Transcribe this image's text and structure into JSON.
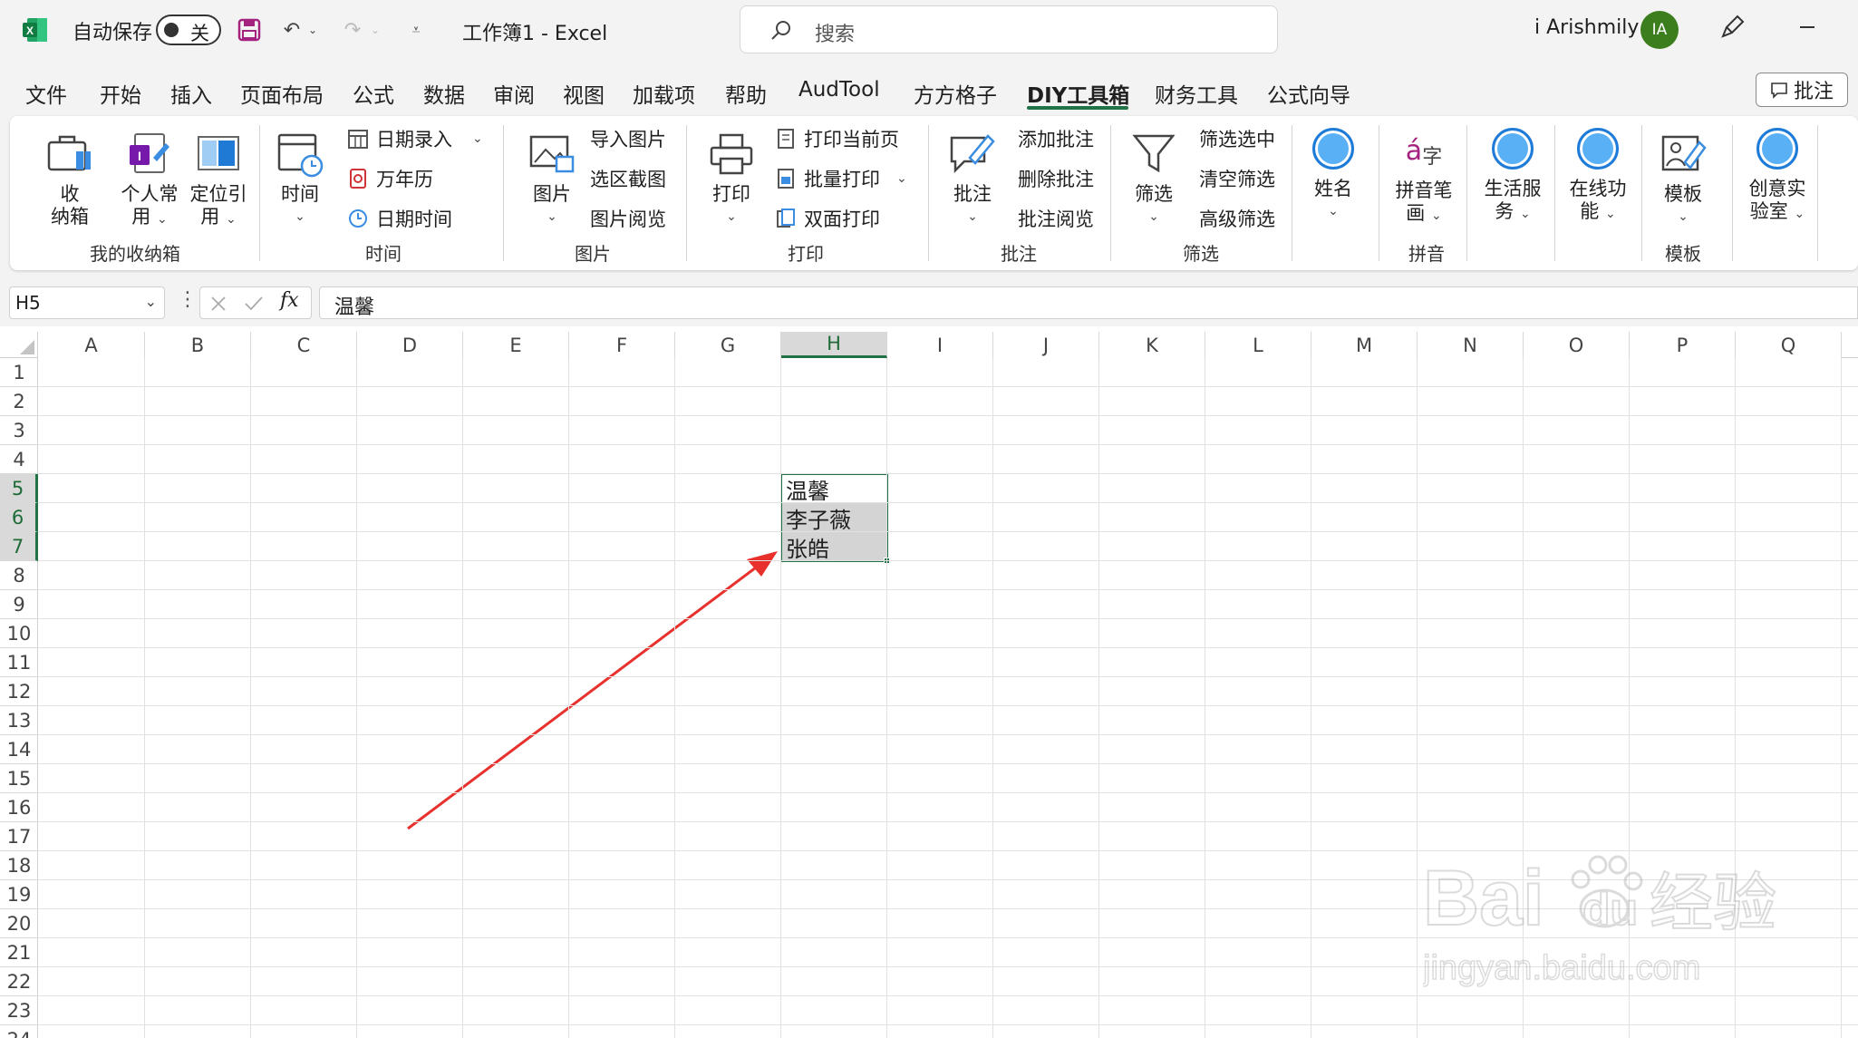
{
  "titlebar": {
    "autosave_label": "自动保存",
    "autosave_state": "关",
    "doc_title": "工作簿1  -  Excel",
    "search_placeholder": "搜索",
    "user_name": "i Arishmily",
    "avatar_initials": "IA"
  },
  "menu": {
    "tabs": [
      "文件",
      "开始",
      "插入",
      "页面布局",
      "公式",
      "数据",
      "审阅",
      "视图",
      "加载项",
      "帮助",
      "AudTool",
      "方方格子",
      "DIY工具箱",
      "财务工具",
      "公式向导"
    ],
    "active_tab": "DIY工具箱",
    "comment_button": "批注"
  },
  "ribbon": {
    "storage": {
      "btn1_line1": "收",
      "btn1_line2": "纳箱",
      "btn2_line1": "个人常",
      "btn2_line2": "用",
      "btn3_line1": "定位引",
      "btn3_line2": "用",
      "label": "我的收纳箱"
    },
    "time": {
      "big": "时间",
      "items": [
        "日期录入",
        "万年历",
        "日期时间"
      ],
      "label": "时间"
    },
    "image": {
      "big": "图片",
      "items": [
        "导入图片",
        "选区截图",
        "图片阅览"
      ],
      "label": "图片"
    },
    "print": {
      "big": "打印",
      "items": [
        "打印当前页",
        "批量打印",
        "双面打印"
      ],
      "label": "打印"
    },
    "comment": {
      "big": "批注",
      "items": [
        "添加批注",
        "删除批注",
        "批注阅览"
      ],
      "label": "批注"
    },
    "filter": {
      "big": "筛选",
      "items": [
        "筛选选中",
        "清空筛选",
        "高级筛选"
      ],
      "label": "筛选"
    },
    "name": {
      "big": "姓名"
    },
    "pinyin": {
      "big_line1": "拼音笔",
      "big_line2": "画",
      "label": "拼音"
    },
    "life": {
      "line1": "生活服",
      "line2": "务"
    },
    "online": {
      "line1": "在线功",
      "line2": "能"
    },
    "template": {
      "big": "模板",
      "label": "模板"
    },
    "lab": {
      "line1": "创意实",
      "line2": "验室"
    }
  },
  "formula_bar": {
    "name_box": "H5",
    "formula": "温馨"
  },
  "sheet": {
    "columns": [
      "A",
      "B",
      "C",
      "D",
      "E",
      "F",
      "G",
      "H",
      "I",
      "J",
      "K",
      "L",
      "M",
      "N",
      "O",
      "P",
      "Q"
    ],
    "rows": [
      "1",
      "2",
      "3",
      "4",
      "5",
      "6",
      "7",
      "8",
      "9",
      "10",
      "11",
      "12",
      "13",
      "14",
      "15",
      "16",
      "17",
      "18",
      "19",
      "20",
      "21",
      "22",
      "23",
      "24"
    ],
    "selected_column": "H",
    "selected_rows": [
      "5",
      "6",
      "7"
    ],
    "cells": {
      "H5": "温馨",
      "H6": "李子薇",
      "H7": "张皓"
    }
  },
  "colors": {
    "accent": "#217346",
    "arrow": "#e8302c"
  },
  "watermark": {
    "brand": "Bai du 经验",
    "url": "jingyan.baidu.com"
  }
}
